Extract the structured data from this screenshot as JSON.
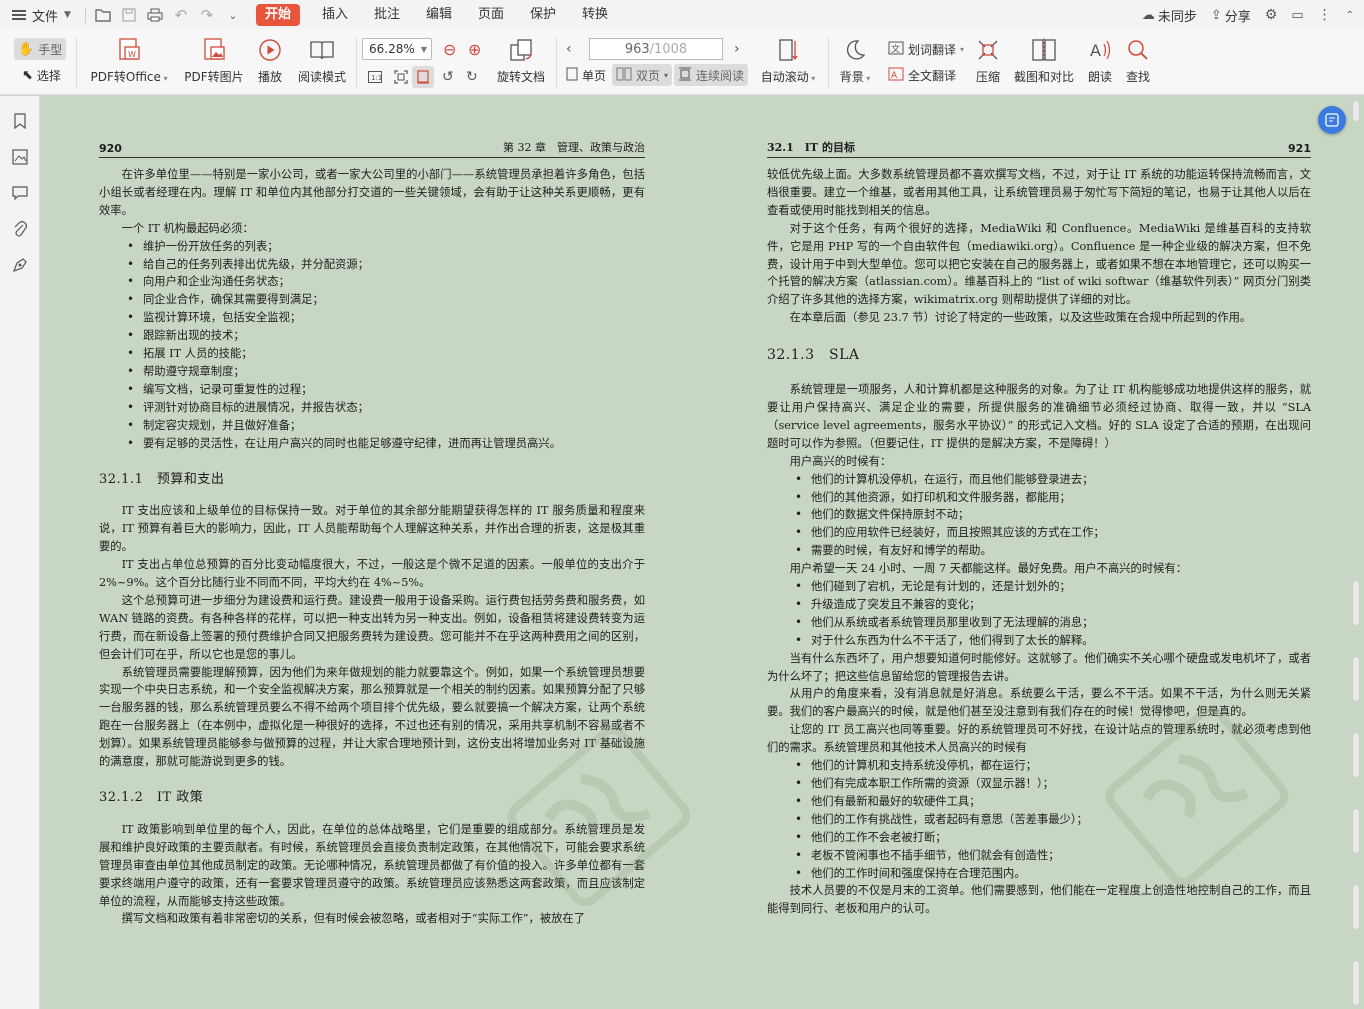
{
  "menubar": {
    "file_label": "文件",
    "tabs": [
      "开始",
      "插入",
      "批注",
      "编辑",
      "页面",
      "保护",
      "转换"
    ],
    "right": {
      "sync": "未同步",
      "share": "分享"
    }
  },
  "ribbon": {
    "hand_tool": "手型",
    "select_tool": "选择",
    "pdf_to_office": "PDF转Office",
    "pdf_to_image": "PDF转图片",
    "play": "播放",
    "read_mode": "阅读模式",
    "zoom_value": "66.28%",
    "rotate_doc": "旋转文档",
    "page_current": "963",
    "page_total": "/1008",
    "single_page": "单页",
    "double_page": "双页",
    "continuous": "连续阅读",
    "auto_scroll": "自动滚动",
    "background": "背景",
    "word_translate": "划词翻译",
    "full_translate": "全文翻译",
    "compress": "压缩",
    "crop_compare": "截图和对比",
    "read_aloud": "朗读",
    "find": "查找"
  },
  "colors": {
    "accent": "#e8543c",
    "page_bg": "#c8d7c3",
    "float_button": "#3b7ae0"
  },
  "left_page": {
    "page_number": "920",
    "header_title": "第 32 章　管理、政策与政治",
    "intro": "在许多单位里——特别是一家小公司，或者一家大公司里的小部门——系统管理员承担着许多角色，包括小组长或者经理在内。理解 IT 和单位内其他部分打交道的一些关键领域，会有助于让这种关系更顺畅，更有效率。",
    "list_intro": "一个 IT 机构最起码必须：",
    "list": [
      "维护一份开放任务的列表；",
      "给自己的任务列表排出优先级，并分配资源；",
      "向用户和企业沟通任务状态；",
      "同企业合作，确保其需要得到满足；",
      "监视计算环境，包括安全监视；",
      "跟踪新出现的技术；",
      "拓展 IT 人员的技能；",
      "帮助遵守规章制度；",
      "编写文档，记录可重复性的过程；",
      "评测针对协商目标的进展情况，并报告状态；",
      "制定容灾规划，并且做好准备；",
      "要有足够的灵活性，在让用户高兴的同时也能足够遵守纪律，进而再让管理员高兴。"
    ],
    "h_budget": "32.1.1　预算和支出",
    "budget_p1": "IT 支出应该和上级单位的目标保持一致。对于单位的其余部分能期望获得怎样的 IT 服务质量和程度来说，IT 预算有着巨大的影响力，因此，IT 人员能帮助每个人理解这种关系，并作出合理的折衷，这是极其重要的。",
    "budget_p2": "IT 支出占单位总预算的百分比变动幅度很大，不过，一般这是个微不足道的因素。一般单位的支出介于 2%~9%。这个百分比随行业不同而不同，平均大约在 4%~5%。",
    "budget_p3": "这个总预算可进一步细分为建设费和运行费。建设费一般用于设备采购。运行费包括劳务费和服务费，如 WAN 链路的资费。有各种各样的花样，可以把一种支出转为另一种支出。例如，设备租赁将建设费转变为运行费，而在新设备上签署的预付费维护合同又把服务费转为建设费。您可能并不在乎这两种费用之间的区别，但会计们可在乎，所以它也是您的事儿。",
    "budget_p4": "系统管理员需要能理解预算，因为他们为来年做规划的能力就要靠这个。例如，如果一个系统管理员想要实现一个中央日志系统，和一个安全监视解决方案，那么预算就是一个相关的制约因素。如果预算分配了只够一台服务器的钱，那么系统管理员要么不得不给两个项目排个优先级，要么就要搞一个解决方案，让两个系统跑在一台服务器上（在本例中，虚拟化是一种很好的选择，不过也还有别的情况，采用共享机制不容易或者不划算）。如果系统管理员能够参与做预算的过程，并让大家合理地预计到，这份支出将增加业务对 IT 基础设施的满意度，那就可能游说到更多的钱。",
    "h_policy": "32.1.2　IT 政策",
    "policy_p1": "IT 政策影响到单位里的每个人，因此，在单位的总体战略里，它们是重要的组成部分。系统管理员是发展和维护良好政策的主要贡献者。有时候，系统管理员会直接负责制定政策，在其他情况下，可能会要求系统管理员审查由单位其他成员制定的政策。无论哪种情况，系统管理员都做了有价值的投入。许多单位都有一套要求终端用户遵守的政策，还有一套要求管理员遵守的政策。系统管理员应该熟悉这两套政策，而且应该制定单位的流程，从而能够支持这些政策。",
    "policy_p2": "撰写文档和政策有着非常密切的关系，但有时候会被忽略，或者相对于“实际工作”，被放在了"
  },
  "right_page": {
    "page_number": "921",
    "header_title": "32.1　IT 的目标",
    "p1": "较低优先级上面。大多数系统管理员都不喜欢撰写文档，不过，对于让 IT 系统的功能运转保持流畅而言，文档很重要。建立一个维基，或者用其他工具，让系统管理员易于匆忙写下简短的笔记，也易于让其他人以后在查看或使用时能找到相关的信息。",
    "p2": "对于这个任务，有两个很好的选择，MediaWiki 和 Confluence。MediaWiki 是维基百科的支持软件，它是用 PHP 写的一个自由软件包（mediawiki.org）。Confluence 是一种企业级的解决方案，但不免费，设计用于中到大型单位。您可以把它安装在自己的服务器上，或者如果不想在本地管理它，还可以购买一个托管的解决方案（atlassian.com）。维基百科上的 “list of wiki softwar（维基软件列表）” 网页分门别类介绍了许多其他的选择方案，wikimatrix.org 则帮助提供了详细的对比。",
    "p3": "在本章后面（参见 23.7 节）讨论了特定的一些政策，以及这些政策在合规中所起到的作用。",
    "h_sla": "32.1.3　SLA",
    "sla_p1": "系统管理是一项服务，人和计算机都是这种服务的对象。为了让 IT 机构能够成功地提供这样的服务，就要让用户保持高兴、满足企业的需要，所提供服务的准确细节必须经过协商、取得一致，并以 “SLA（service level agreements，服务水平协议）” 的形式记入文档。好的 SLA 设定了合适的预期，在出现问题时可以作为参照。（但要记住，IT 提供的是解决方案，不是障碍！）",
    "happy_intro": "用户高兴的时候有：",
    "happy_list": [
      "他们的计算机没停机，在运行，而且他们能够登录进去；",
      "他们的其他资源，如打印机和文件服务器，都能用；",
      "他们的数据文件保持原封不动；",
      "他们的应用软件已经装好，而且按照其应该的方式在工作；",
      "需要的时候，有友好和博学的帮助。"
    ],
    "unhappy_intro": "用户希望一天 24 小时、一周 7 天都能这样。最好免费。用户不高兴的时候有：",
    "unhappy_list": [
      "他们碰到了宕机，无论是有计划的，还是计划外的；",
      "升级造成了突发且不兼容的变化；",
      "他们从系统或者系统管理员那里收到了无法理解的消息；",
      "对于什么东西为什么不干活了，他们得到了太长的解释。"
    ],
    "p4": "当有什么东西坏了，用户想要知道何时能修好。这就够了。他们确实不关心哪个硬盘或发电机坏了，或者为什么坏了；把这些信息留给您的管理报告去讲。",
    "p5": "从用户的角度来看，没有消息就是好消息。系统要么干活，要么不干活。如果不干活，为什么则无关紧要。我们的客户最高兴的时候，就是他们甚至没注意到有我们存在的时候！觉得惨吧，但是真的。",
    "p6": "让您的 IT 员工高兴也同等重要。好的系统管理员可不好找，在设计站点的管理系统时，就必须考虑到他们的需求。系统管理员和其他技术人员高兴的时候有",
    "staff_list": [
      "他们的计算机和支持系统没停机，都在运行；",
      "他们有完成本职工作所需的资源（双显示器！）；",
      "他们有最新和最好的软硬件工具；",
      "他们的工作有挑战性，或者起码有意思（苦差事最少）；",
      "他们的工作不会老被打断；",
      "老板不管闲事也不插手细节，他们就会有创造性；",
      "他们的工作时间和强度保持在合理范围内。"
    ],
    "p7": "技术人员要的不仅是月末的工资单。他们需要感到，他们能在一定程度上创造性地控制自己的工作，而且能得到同行、老板和用户的认可。"
  }
}
